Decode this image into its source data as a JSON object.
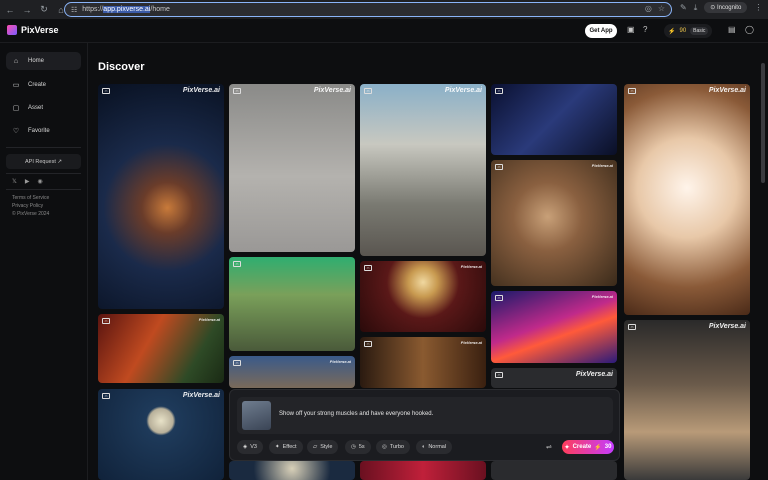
{
  "browser": {
    "url_prefix": "https://",
    "url_host": "app.pixverse.ai",
    "url_path": "/home",
    "incognito_label": "Incognito"
  },
  "app": {
    "brand": "PixVerse",
    "get_app": "Get App",
    "credits": "90",
    "plan": "Basic"
  },
  "sidebar": {
    "items": [
      {
        "label": "Home",
        "icon": "home-icon"
      },
      {
        "label": "Create",
        "icon": "create-icon"
      },
      {
        "label": "Asset",
        "icon": "folder-icon"
      },
      {
        "label": "Favorite",
        "icon": "heart-icon"
      }
    ],
    "api_request": "API Request ↗",
    "legal": [
      "Terms of Service",
      "Privacy Policy",
      "© PixVerse 2024"
    ]
  },
  "main": {
    "title": "Discover",
    "watermark": "PixVerse.ai"
  },
  "prompt": {
    "text": "Show off your strong muscles and have everyone hooked.",
    "options": [
      "V3",
      "Effect",
      "Style",
      "5s",
      "Turbo",
      "Normal"
    ],
    "create_label": "Create",
    "create_cost": "30"
  },
  "colors": {
    "accent_from": "#ff3d5a",
    "accent_to": "#c43cff",
    "background": "#0d0e10"
  }
}
